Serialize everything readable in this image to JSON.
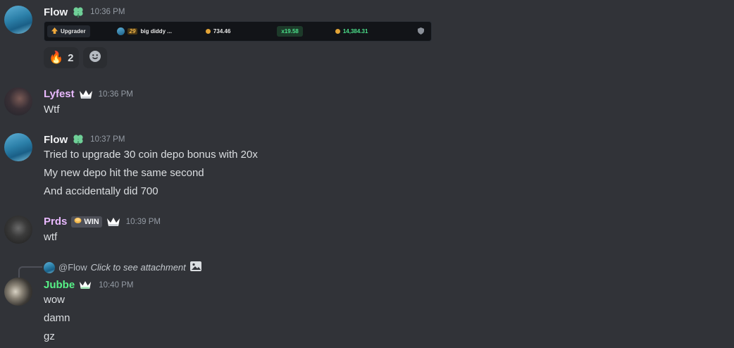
{
  "messages": [
    {
      "author": "Flow",
      "author_color": "#f2f3f5",
      "time": "10:36 PM",
      "embed": {
        "mode_label": "Upgrader",
        "level": "29",
        "player": "big diddy ...",
        "bet": "734.46",
        "multiplier": "x19.58",
        "payout": "14,384.31"
      },
      "reactions": [
        {
          "emoji": "🔥",
          "count": "2"
        }
      ]
    },
    {
      "author": "Lyfest",
      "author_color": "#e9b9ff",
      "time": "10:36 PM",
      "lines": [
        "Wtf"
      ]
    },
    {
      "author": "Flow",
      "author_color": "#f2f3f5",
      "time": "10:37 PM",
      "lines": [
        "Tried to upgrade 30 coin depo bonus with 20x",
        "My new depo hit the same second",
        "And accidentally did 700"
      ]
    },
    {
      "author": "Prds",
      "author_color": "#e9b9ff",
      "tag": "WIN",
      "time": "10:39 PM",
      "lines": [
        "wtf"
      ]
    },
    {
      "reply_to": "@Flow",
      "reply_text": "Click to see attachment",
      "author": "Jubbe",
      "author_color": "#57f287",
      "time": "10:40 PM",
      "lines": [
        "wow",
        "damn",
        "gz"
      ]
    }
  ]
}
